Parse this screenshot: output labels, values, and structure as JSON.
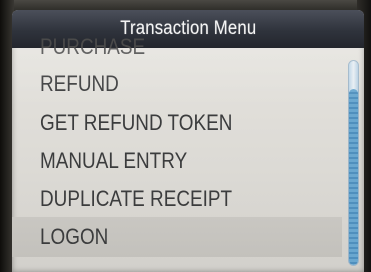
{
  "header": {
    "title": "Transaction Menu"
  },
  "menu": {
    "items": [
      {
        "label": "PURCHASE"
      },
      {
        "label": "REFUND"
      },
      {
        "label": "GET REFUND TOKEN"
      },
      {
        "label": "MANUAL ENTRY"
      },
      {
        "label": "DUPLICATE RECEIPT"
      },
      {
        "label": "LOGON"
      }
    ],
    "selected_index": 5
  },
  "colors": {
    "header_bg": "#2f333c",
    "screen_bg": "#dcdad5",
    "selected_bg": "#c6c4bf",
    "text": "#3b3c3d",
    "scroll_accent": "#5b9bc8"
  }
}
